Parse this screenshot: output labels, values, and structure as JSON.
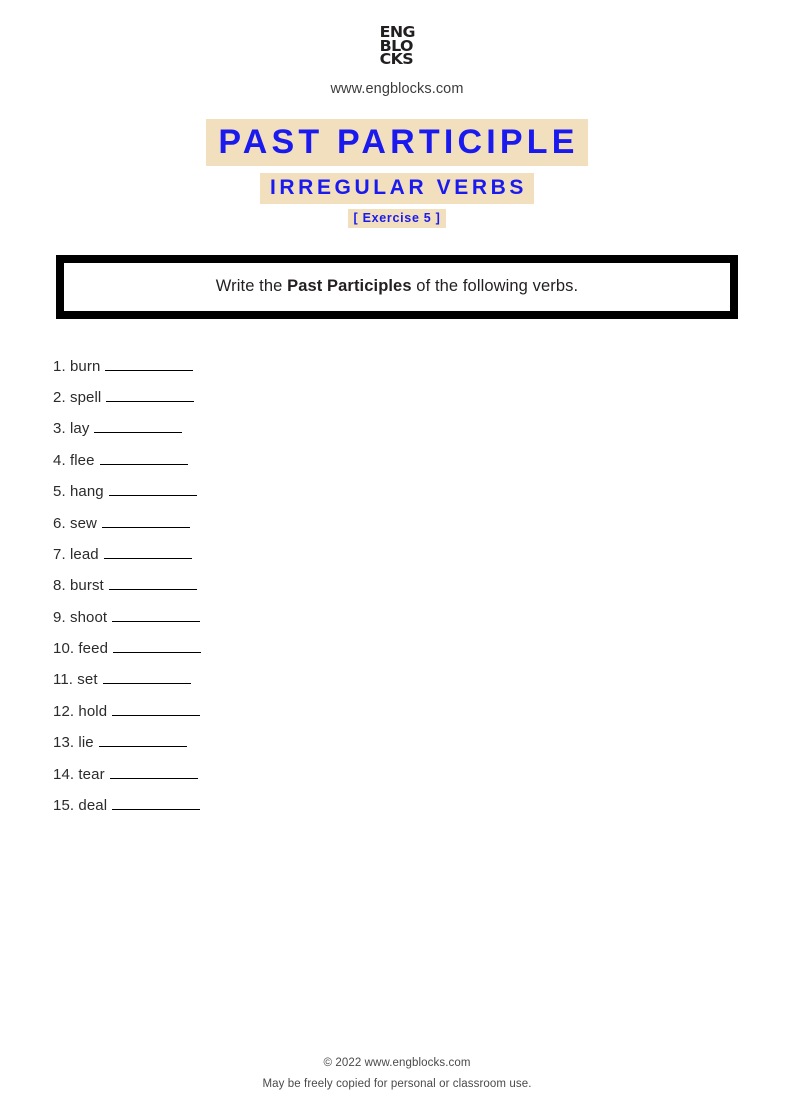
{
  "header": {
    "logo_lines": [
      "ENG",
      "BLO",
      "CKS"
    ],
    "site_url": "www.engblocks.com"
  },
  "titles": {
    "main": "PAST PARTICIPLE",
    "sub": "IRREGULAR VERBS",
    "exercise": "[ Exercise 5 ]"
  },
  "instruction": {
    "before": "Write the ",
    "bold": "Past Participles",
    "after": " of the following verbs."
  },
  "exercise_items": [
    {
      "number": "1.",
      "verb": "burn"
    },
    {
      "number": "2.",
      "verb": "spell"
    },
    {
      "number": "3.",
      "verb": "lay"
    },
    {
      "number": "4.",
      "verb": "flee"
    },
    {
      "number": "5.",
      "verb": "hang"
    },
    {
      "number": "6.",
      "verb": "sew"
    },
    {
      "number": "7.",
      "verb": "lead"
    },
    {
      "number": "8.",
      "verb": "burst"
    },
    {
      "number": "9.",
      "verb": "shoot"
    },
    {
      "number": "10.",
      "verb": "feed"
    },
    {
      "number": "11.",
      "verb": "set"
    },
    {
      "number": "12.",
      "verb": "hold"
    },
    {
      "number": "13.",
      "verb": "lie"
    },
    {
      "number": "14.",
      "verb": "tear"
    },
    {
      "number": "15.",
      "verb": "deal"
    }
  ],
  "footer": {
    "copyright": "© 2022 www.engblocks.com",
    "note": "May be freely copied for personal or classroom use."
  },
  "colors": {
    "highlight": "#f2dfbe",
    "title_blue": "#1a1aee",
    "border_black": "#000000",
    "page_background": "#ffffff"
  }
}
